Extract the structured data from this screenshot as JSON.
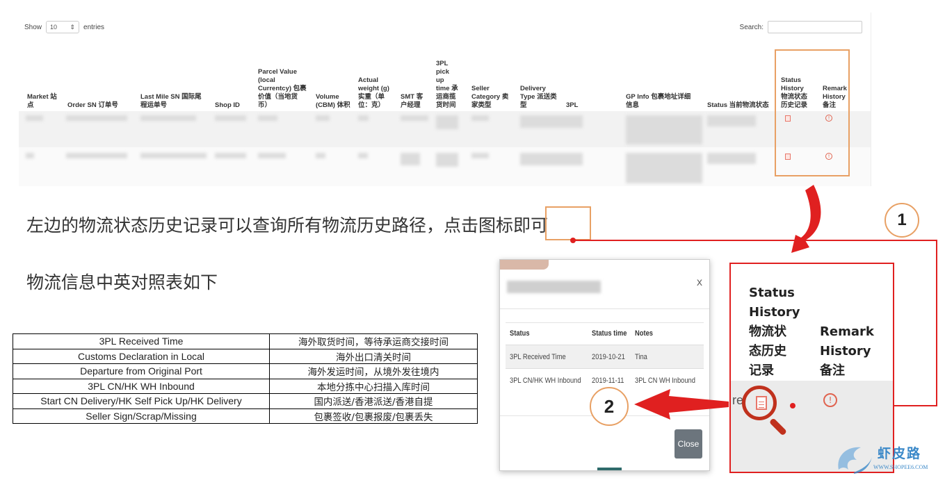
{
  "table_screenshot": {
    "length_prefix": "Show",
    "length_value": "10",
    "length_suffix": "entries",
    "search_label": "Search:",
    "columns": [
      "Market 站点",
      "Order SN 订单号",
      "Last Mile SN 国际尾程运单号",
      "Shop ID",
      "Parcel Value (local Currentcy) 包裹价值（当地货币）",
      "Volume (CBM) 体积",
      "Actual weight (g) 实重（单位：克）",
      "SMT 客户经理",
      "3PL pick up time 承运商揽货时间",
      "Seller Category 卖家类型",
      "Delivery Type 派送类型",
      "3PL",
      "GP Info 包裹地址详细信息",
      "Status 当前物流状态",
      "Status History 物流状态历史记录",
      "Remark History 备注"
    ],
    "file_icon": "file-icon",
    "info_icon": "info-circle-icon"
  },
  "description": {
    "line1": "左边的物流状态历史记录可以查询所有物流历史路径，点击图标即可",
    "line2": "物流信息中英对照表如下"
  },
  "translation_table": [
    {
      "en": "3PL Received Time",
      "cn": "海外取货时间，等待承运商交接时间"
    },
    {
      "en": "Customs Declaration in Local",
      "cn": "海外出口清关时间"
    },
    {
      "en": "Departure from Original Port",
      "cn": "海外发运时间，从境外发往境内"
    },
    {
      "en": "3PL CN/HK WH Inbound",
      "cn": "本地分拣中心扫描入库时间"
    },
    {
      "en": "Start CN Delivery/HK Self Pick Up/HK Delivery",
      "cn": "国内派送/香港派送/香港自提"
    },
    {
      "en": "Seller Sign/Scrap/Missing",
      "cn": "包裹签收/包裹报废/包裹丢失"
    }
  ],
  "modal": {
    "close_x": "x",
    "headers": [
      "Status",
      "Status time",
      "Notes"
    ],
    "rows": [
      {
        "status": "3PL Received Time",
        "time": "2019-10-21",
        "notes": "Tina"
      },
      {
        "status": "3PL CN/HK WH Inbound",
        "time": "2019-11-11",
        "notes": "3PL CN WH Inbound"
      }
    ],
    "close_button": "Close"
  },
  "zoom_panel": {
    "status_history_label": "Status History 物流状态历史记录",
    "status_history_lines": [
      "Status",
      "History",
      "物流状",
      "态历史",
      "记录"
    ],
    "remark_lines": [
      "Remark",
      "History",
      "备注"
    ],
    "cut_text": "re",
    "magnifier_icon": "magnifier-icon"
  },
  "annotations": {
    "step1": "1",
    "step2": "2",
    "accent_red": "#e02020",
    "accent_orange": "#e8a064"
  },
  "watermark": {
    "title": "虾皮路",
    "url": "WWW.SHOPEE6.COM"
  }
}
